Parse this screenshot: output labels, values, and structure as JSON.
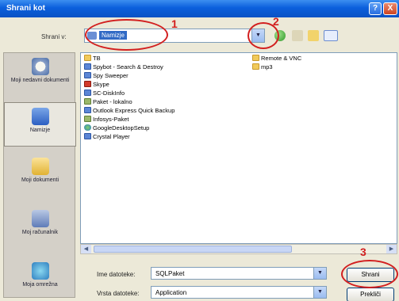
{
  "window": {
    "title": "Shrani kot",
    "help": "?",
    "close": "X"
  },
  "lookin": {
    "label": "Shrani v:",
    "value": "Namizje"
  },
  "places": [
    {
      "label": "Moji nedavni dokumenti"
    },
    {
      "label": "Namizje"
    },
    {
      "label": "Moji dokumenti"
    },
    {
      "label": "Moj računalnik"
    },
    {
      "label": "Moja omrežna"
    }
  ],
  "files": [
    {
      "name": "TB",
      "icon": "folder"
    },
    {
      "name": "Spybot - Search & Destroy",
      "icon": "app"
    },
    {
      "name": "Spy Sweeper",
      "icon": "app"
    },
    {
      "name": "Skype",
      "icon": "red"
    },
    {
      "name": "SC-DiskInfo",
      "icon": "app"
    },
    {
      "name": "Paket - lokalno",
      "icon": "shortcut"
    },
    {
      "name": "Outlook Express Quick Backup",
      "icon": "app"
    },
    {
      "name": "Infosys-Paket",
      "icon": "shortcut"
    },
    {
      "name": "GoogleDesktopSetup",
      "icon": "globe"
    },
    {
      "name": "Crystal Player",
      "icon": "app"
    },
    {
      "name": "Remote & VNC",
      "icon": "folder"
    },
    {
      "name": "mp3",
      "icon": "folder"
    }
  ],
  "form": {
    "filename_label": "Ime datoteke:",
    "filename_value": "SQLPaket",
    "filetype_label": "Vrsta datoteke:",
    "filetype_value": "Application"
  },
  "buttons": {
    "save": "Shrani",
    "cancel": "Prekliči"
  },
  "annotations": [
    "1",
    "2",
    "3"
  ],
  "colors": {
    "annotation": "#d21f1f",
    "titlebar": "#0b5fdc"
  }
}
